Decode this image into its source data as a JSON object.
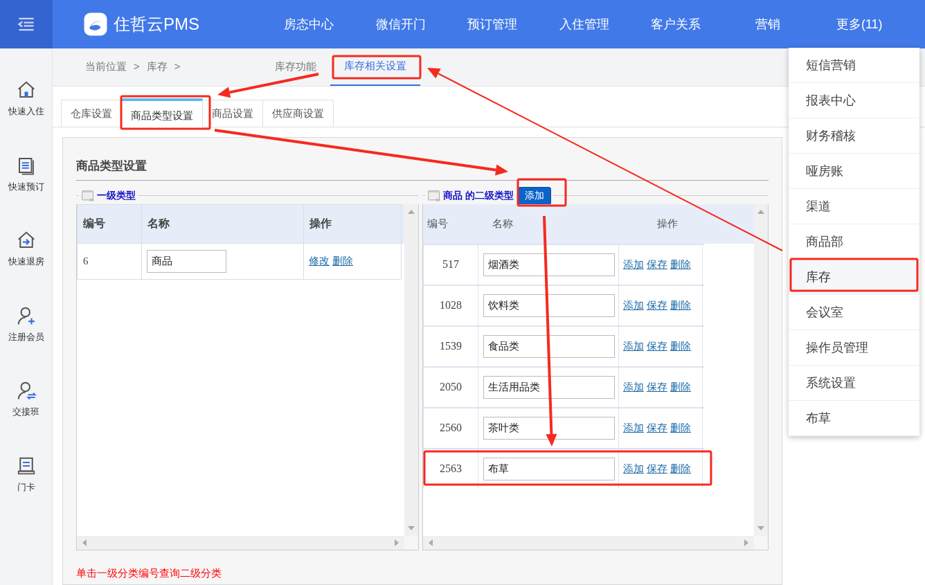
{
  "header": {
    "brand": "住哲云PMS",
    "nav": [
      "房态中心",
      "微信开门",
      "预订管理",
      "入住管理",
      "客户关系",
      "营销",
      "更多(11)"
    ]
  },
  "more_menu": [
    {
      "label": "短信营销",
      "selected": false
    },
    {
      "label": "报表中心",
      "selected": false
    },
    {
      "label": "财务稽核",
      "selected": false
    },
    {
      "label": "哑房账",
      "selected": false
    },
    {
      "label": "渠道",
      "selected": false
    },
    {
      "label": "商品部",
      "selected": false
    },
    {
      "label": "库存",
      "selected": true
    },
    {
      "label": "会议室",
      "selected": false
    },
    {
      "label": "操作员管理",
      "selected": false
    },
    {
      "label": "系统设置",
      "selected": false
    },
    {
      "label": "布草",
      "selected": false
    }
  ],
  "sidebar": [
    {
      "kind": "checkin",
      "label": "快速入住"
    },
    {
      "kind": "booking",
      "label": "快速预订"
    },
    {
      "kind": "checkout",
      "label": "快速退房"
    },
    {
      "kind": "member",
      "label": "注册会员"
    },
    {
      "kind": "shift",
      "label": "交接班"
    },
    {
      "kind": "card",
      "label": "门卡"
    }
  ],
  "breadcrumb": {
    "items": [
      "当前位置",
      "库存"
    ],
    "separator": ">"
  },
  "sub_tabs": [
    {
      "label": "库存功能",
      "selected": false
    },
    {
      "label": "库存相关设置",
      "selected": true
    }
  ],
  "tabs": [
    {
      "label": "仓库设置",
      "selected": false
    },
    {
      "label": "商品类型设置",
      "selected": true
    },
    {
      "label": "商品设置",
      "selected": false
    },
    {
      "label": "供应商设置",
      "selected": false
    }
  ],
  "section_title": "商品类型设置",
  "level1": {
    "legend": "一级类型",
    "columns": [
      "编号",
      "名称",
      "操作"
    ],
    "rows": [
      {
        "id": "6",
        "name": "商品",
        "actions": [
          "修改",
          "删除"
        ]
      }
    ]
  },
  "level2": {
    "legend": "商品 的二级类型",
    "add_button": "添加",
    "columns": [
      "编号",
      "名称",
      "操作"
    ],
    "rows": [
      {
        "id": "517",
        "name": "烟酒类",
        "actions": [
          "添加",
          "保存",
          "删除"
        ]
      },
      {
        "id": "1028",
        "name": "饮料类",
        "actions": [
          "添加",
          "保存",
          "删除"
        ]
      },
      {
        "id": "1539",
        "name": "食品类",
        "actions": [
          "添加",
          "保存",
          "删除"
        ]
      },
      {
        "id": "2050",
        "name": "生活用品类",
        "actions": [
          "添加",
          "保存",
          "删除"
        ]
      },
      {
        "id": "2560",
        "name": "茶叶类",
        "actions": [
          "添加",
          "保存",
          "删除"
        ]
      },
      {
        "id": "2563",
        "name": "布草",
        "actions": [
          "添加",
          "保存",
          "删除"
        ]
      }
    ]
  },
  "note": "单击一级分类编号查询二级分类"
}
